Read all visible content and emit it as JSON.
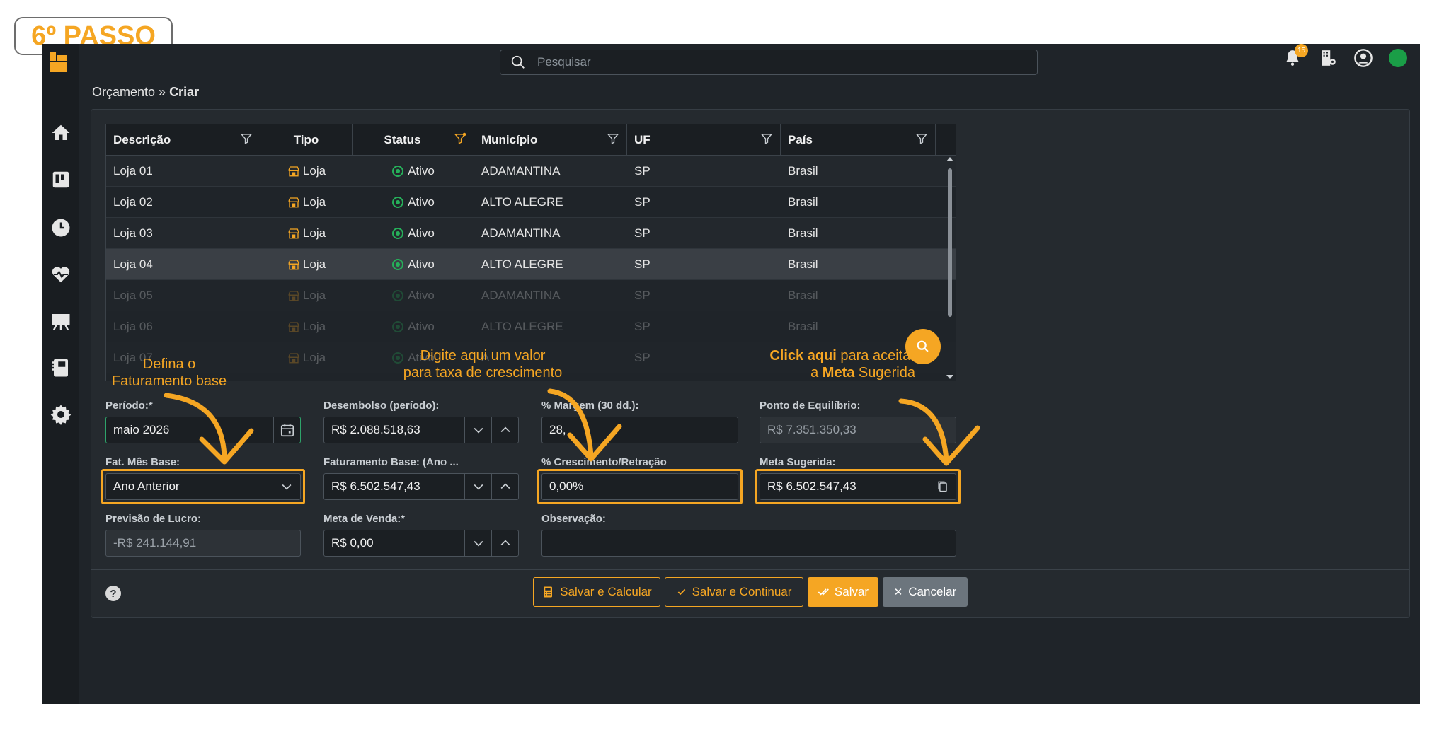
{
  "step_label": "6º PASSO",
  "search": {
    "placeholder": "Pesquisar"
  },
  "notifications": {
    "count": "15"
  },
  "breadcrumb": {
    "parent": "Orçamento",
    "separator": " » ",
    "current": "Criar"
  },
  "grid": {
    "columns": [
      "Descrição",
      "Tipo",
      "Status",
      "Município",
      "UF",
      "País"
    ],
    "rows": [
      {
        "descricao": "Loja 01",
        "tipo": "Loja",
        "status": "Ativo",
        "municipio": "ADAMANTINA",
        "uf": "SP",
        "pais": "Brasil"
      },
      {
        "descricao": "Loja 02",
        "tipo": "Loja",
        "status": "Ativo",
        "municipio": "ALTO ALEGRE",
        "uf": "SP",
        "pais": "Brasil"
      },
      {
        "descricao": "Loja 03",
        "tipo": "Loja",
        "status": "Ativo",
        "municipio": "ADAMANTINA",
        "uf": "SP",
        "pais": "Brasil"
      },
      {
        "descricao": "Loja 04",
        "tipo": "Loja",
        "status": "Ativo",
        "municipio": "ALTO ALEGRE",
        "uf": "SP",
        "pais": "Brasil"
      },
      {
        "descricao": "Loja 05",
        "tipo": "Loja",
        "status": "Ativo",
        "municipio": "ADAMANTINA",
        "uf": "SP",
        "pais": "Brasil"
      },
      {
        "descricao": "Loja 06",
        "tipo": "Loja",
        "status": "Ativo",
        "municipio": "ALTO ALEGRE",
        "uf": "SP",
        "pais": "Brasil"
      },
      {
        "descricao": "Loja 07",
        "tipo": "Loja",
        "status": "Ativo",
        "municipio": "A",
        "uf": "SP",
        "pais": ""
      }
    ]
  },
  "form": {
    "periodo": {
      "label": "Período:*",
      "value": "maio 2026"
    },
    "desembolso": {
      "label": "Desembolso (período):",
      "value": "R$ 2.088.518,63"
    },
    "margem": {
      "label": "% Margem (30 dd.):",
      "value": "28,"
    },
    "ponto_equilibrio": {
      "label": "Ponto de Equilíbrio:",
      "value": "R$ 7.351.350,33"
    },
    "fat_mes_base": {
      "label": "Fat. Mês Base:",
      "value": "Ano Anterior"
    },
    "faturamento_base": {
      "label": "Faturamento Base: (Ano ...",
      "value": "R$ 6.502.547,43"
    },
    "crescimento": {
      "label": "% Crescimento/Retração",
      "value": "0,00%"
    },
    "meta_sugerida": {
      "label": "Meta Sugerida:",
      "value": "R$ 6.502.547,43"
    },
    "previsao_lucro": {
      "label": "Previsão de Lucro:",
      "value": "-R$ 241.144,91"
    },
    "meta_venda": {
      "label": "Meta de Venda:*",
      "value": "R$ 0,00"
    },
    "observacao": {
      "label": "Observação:",
      "value": ""
    }
  },
  "buttons": {
    "salvar_calcular": "Salvar e Calcular",
    "salvar_continuar": "Salvar e Continuar",
    "salvar": "Salvar",
    "cancelar": "Cancelar",
    "help": "?"
  },
  "annotations": {
    "faturamento_line1": "Defina o",
    "faturamento_line2": "Faturamento base",
    "crescimento_line1": "Digite aqui um valor",
    "crescimento_line2": "para taxa de crescimento",
    "meta_bold1": "Click aqui",
    "meta_rest1": " para  aceitar",
    "meta_pre2": "a ",
    "meta_bold2": "Meta",
    "meta_rest2": " Sugerida"
  },
  "colors": {
    "accent": "#f5a623",
    "background": "#1f2429",
    "panel": "#252a2f",
    "active": "#26b05a"
  }
}
